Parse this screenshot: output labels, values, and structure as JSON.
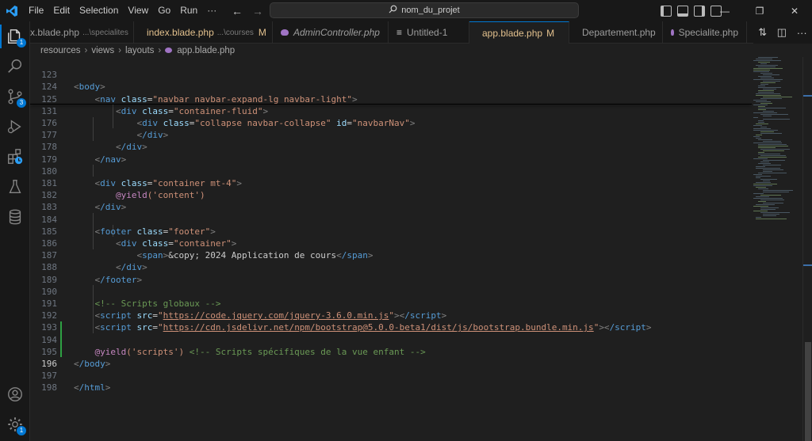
{
  "menu": [
    "File",
    "Edit",
    "Selection",
    "View",
    "Go",
    "Run",
    "···"
  ],
  "search": {
    "text": "nom_du_projet"
  },
  "tabs": [
    {
      "name": "x.blade.php",
      "path": "...\\specialites",
      "modified": false,
      "active": false
    },
    {
      "name": "index.blade.php",
      "path": "...\\courses",
      "badge": "M",
      "modified": true,
      "active": false
    },
    {
      "name": "AdminController.php",
      "path": "",
      "modified": false,
      "active": false,
      "italic": true
    },
    {
      "name": "Untitled-1",
      "path": "",
      "modified": false,
      "active": false
    },
    {
      "name": "app.blade.php",
      "badge": "M",
      "modified": true,
      "active": true,
      "unsaved": true
    },
    {
      "name": "Departement.php",
      "path": "",
      "modified": false,
      "active": false
    },
    {
      "name": "Specialite.php",
      "path": "",
      "modified": false,
      "active": false
    }
  ],
  "breadcrumb": [
    "resources",
    "views",
    "layouts",
    "app.blade.php"
  ],
  "activity_badges": {
    "explorer": "1",
    "source_control": "3",
    "settings": "1"
  },
  "lines": [
    {
      "n": "123",
      "sticky": true
    },
    {
      "n": "124",
      "sticky": true
    },
    {
      "n": "125",
      "sticky": true
    },
    {
      "n": "131",
      "sticky": true
    },
    {
      "n": "176"
    },
    {
      "n": "177"
    },
    {
      "n": "178"
    },
    {
      "n": "179"
    },
    {
      "n": "180"
    },
    {
      "n": "181"
    },
    {
      "n": "182"
    },
    {
      "n": "183"
    },
    {
      "n": "184"
    },
    {
      "n": "185"
    },
    {
      "n": "186"
    },
    {
      "n": "187"
    },
    {
      "n": "188"
    },
    {
      "n": "189"
    },
    {
      "n": "190"
    },
    {
      "n": "191"
    },
    {
      "n": "192"
    },
    {
      "n": "193"
    },
    {
      "n": "194"
    },
    {
      "n": "195"
    },
    {
      "n": "196"
    },
    {
      "n": "197"
    },
    {
      "n": "198"
    }
  ],
  "code": {
    "l123_tag": "body",
    "l124_tag": "nav",
    "l124_attr": "class",
    "l124_val": "\"navbar navbar-expand-lg navbar-light\"",
    "l125_tag": "div",
    "l125_attr": "class",
    "l125_val": "\"container-fluid\"",
    "l131_tag": "div",
    "l131_attr": "class",
    "l131_val": "\"collapse navbar-collapse\"",
    "l131_attr2": "id",
    "l131_val2": "\"navbarNav\"",
    "l176_tag": "/div",
    "l177_tag": "/div",
    "l178_tag": "/nav",
    "l180_tag": "div",
    "l180_attr": "class",
    "l180_val": "\"container mt-4\"",
    "l181_dir": "@yield",
    "l181_arg": "('content')",
    "l182_tag": "/div",
    "l184_tag": "footer",
    "l184_attr": "class",
    "l184_val": "\"footer\"",
    "l185_tag": "div",
    "l185_attr": "class",
    "l185_val": "\"container\"",
    "l186_tag": "span",
    "l186_text": "&copy; 2024 Application de cours",
    "l186_close": "/span",
    "l187_tag": "/div",
    "l188_tag": "/footer",
    "l190_comment": "<!-- Scripts globaux -->",
    "l191_tag": "script",
    "l191_attr": "src",
    "l191_url": "https://code.jquery.com/jquery-3.6.0.min.js",
    "l191_close": "/script",
    "l192_tag": "script",
    "l192_attr": "src",
    "l192_url": "https://cdn.jsdelivr.net/npm/bootstrap@5.0.0-beta1/dist/js/bootstrap.bundle.min.js",
    "l192_close": "/script",
    "l194_dir": "@yield",
    "l194_arg": "('scripts')",
    "l194_comment": "<!-- Scripts spécifiques de la vue enfant -->",
    "l195_tag": "/body",
    "l197_tag": "/html"
  },
  "colors": {
    "accent": "#0078d4",
    "tag": "#569cd6",
    "attr": "#9cdcfe",
    "string": "#ce9178",
    "comment": "#6a9955",
    "directive": "#c586c0",
    "modified": "#e2c08d",
    "added": "#2ea043"
  }
}
